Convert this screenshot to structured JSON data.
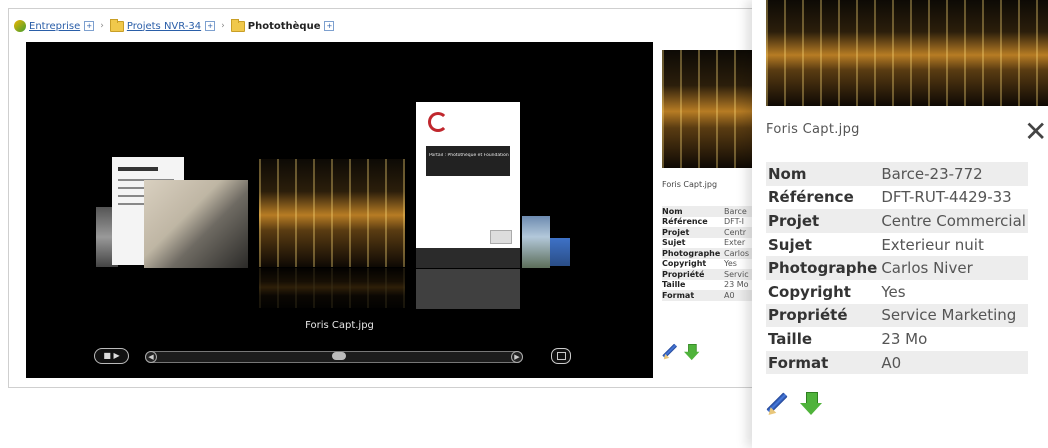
{
  "breadcrumb": [
    {
      "label": "Entreprise",
      "link": true
    },
    {
      "label": "Projets NVR-34",
      "link": true
    },
    {
      "label": "Photothèque",
      "link": false
    }
  ],
  "viewer": {
    "current_caption": "Foris Capt.jpg",
    "doc_card_title": "Portail : Photothèque et Foundation",
    "scroll_position_pct": 52
  },
  "side_panel": {
    "filename": "Foris Capt.jpg",
    "fields": [
      {
        "label": "Nom",
        "value": "Barce"
      },
      {
        "label": "Référence",
        "value": "DFT-I"
      },
      {
        "label": "Projet",
        "value": "Centr"
      },
      {
        "label": "Sujet",
        "value": "Exter"
      },
      {
        "label": "Photographe",
        "value": "Carlos"
      },
      {
        "label": "Copyright",
        "value": "Yes"
      },
      {
        "label": "Propriété",
        "value": "Servic"
      },
      {
        "label": "Taille",
        "value": "23 Mo"
      },
      {
        "label": "Format",
        "value": "A0"
      }
    ]
  },
  "popup": {
    "filename": "Foris Capt.jpg",
    "close_symbol": "✕",
    "fields": [
      {
        "label": "Nom",
        "value": "Barce-23-772"
      },
      {
        "label": "Référence",
        "value": "DFT-RUT-4429-33"
      },
      {
        "label": "Projet",
        "value": "Centre Commercial"
      },
      {
        "label": "Sujet",
        "value": "Exterieur nuit"
      },
      {
        "label": "Photographe",
        "value": "Carlos Niver"
      },
      {
        "label": "Copyright",
        "value": "Yes"
      },
      {
        "label": "Propriété",
        "value": "Service Marketing"
      },
      {
        "label": "Taille",
        "value": "23 Mo"
      },
      {
        "label": "Format",
        "value": "A0"
      }
    ]
  },
  "icons": {
    "edit": "pencil-icon",
    "download": "download-arrow-icon",
    "play": "play-pause-icon",
    "fullscreen": "fullscreen-icon"
  }
}
